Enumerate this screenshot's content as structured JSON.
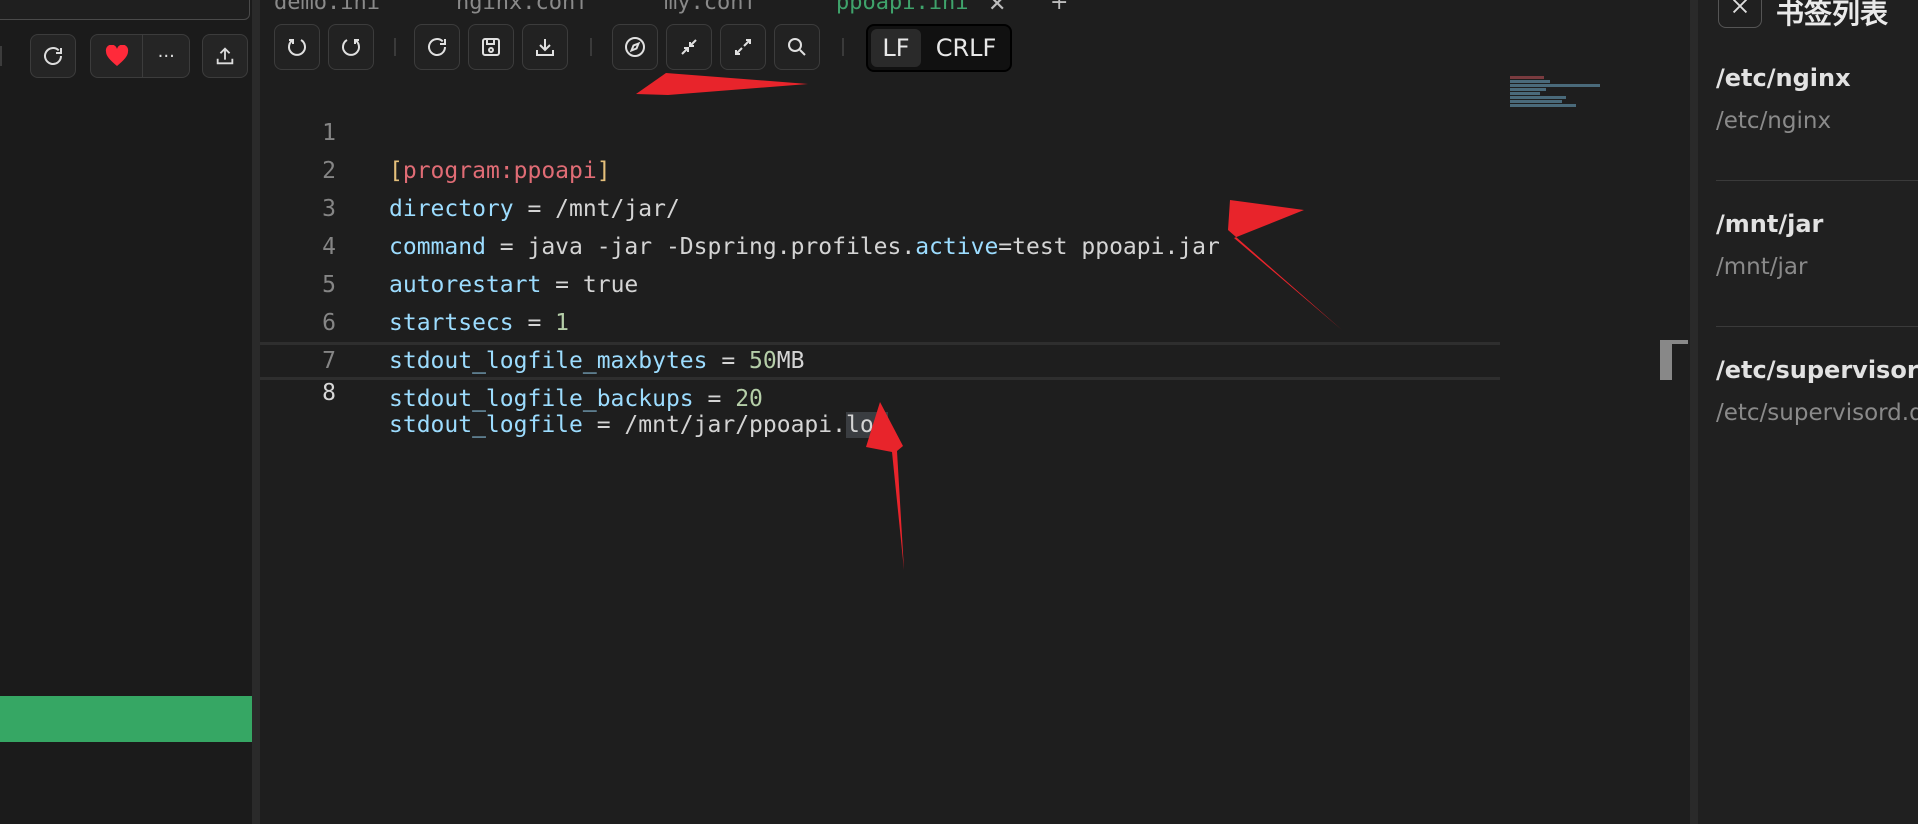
{
  "tabs": [
    {
      "label": "demo.ini",
      "active": false
    },
    {
      "label": "nginx.conf",
      "active": false
    },
    {
      "label": "my.conf",
      "active": false
    },
    {
      "label": "ppoapi.ini",
      "active": true
    }
  ],
  "toolbar": {
    "undo": "undo-icon",
    "redo": "redo-icon",
    "reload": "reload-icon",
    "save": "save-icon",
    "download": "download-icon",
    "compass": "compass-icon",
    "collapse": "collapse-icon",
    "expand": "expand-icon",
    "search": "search-icon",
    "line_endings": {
      "lf": "LF",
      "crlf": "CRLF",
      "selected": "LF"
    }
  },
  "left_panel": {
    "buttons": [
      "refresh-icon",
      "heart-icon",
      "more-icon",
      "upload-icon"
    ],
    "more_label": "···"
  },
  "editor": {
    "current_line": 8,
    "lines": [
      {
        "n": "1",
        "text": "[program:ppoapi]"
      },
      {
        "n": "2",
        "text": "directory = /mnt/jar/"
      },
      {
        "n": "3",
        "text": "command = java -jar -Dspring.profiles.active=test ppoapi.jar"
      },
      {
        "n": "4",
        "text": "autorestart = true"
      },
      {
        "n": "5",
        "text": "startsecs = 1"
      },
      {
        "n": "6",
        "text": "stdout_logfile_maxbytes = 50MB"
      },
      {
        "n": "7",
        "text": "stdout_logfile_backups = 20"
      },
      {
        "n": "8",
        "text": "stdout_logfile = /mnt/jar/ppoapi.log"
      }
    ]
  },
  "bookmarks": {
    "title": "书签列表",
    "items": [
      {
        "name": "/etc/nginx",
        "path": "/etc/nginx"
      },
      {
        "name": "/mnt/jar",
        "path": "/mnt/jar"
      },
      {
        "name": "/etc/supervisord",
        "path": "/etc/supervisord.d"
      }
    ]
  },
  "colors": {
    "accent_green": "#36a764",
    "active_tab": "#3fa36b",
    "annotation_arrow": "#e8242b",
    "heart": "#ff2a3a"
  }
}
